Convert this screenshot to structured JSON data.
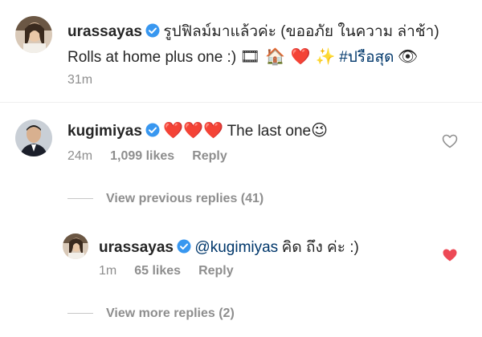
{
  "caption": {
    "username": "urassayas",
    "text_line1": "รูปฟิลม์มาแล้วค่ะ (ขออภัย ในความ ล่าช้า)",
    "text_line2": "Rolls at home plus one :)",
    "emojis": "🎞 🏠 ❤️ ✨",
    "hashtag": "#ปรือสุด",
    "trailing_emoji": "👁",
    "time": "31m"
  },
  "comment": {
    "username": "kugimiyas",
    "hearts": "❤️❤️❤️",
    "text": "The last one",
    "wink": "😉",
    "time": "24m",
    "likes": "1,099 likes",
    "reply_label": "Reply"
  },
  "view_previous": "View previous replies (41)",
  "reply": {
    "username": "urassayas",
    "mention": "@kugimiyas",
    "text": "คิด ถึง ค่ะ :)",
    "time": "1m",
    "likes": "65 likes",
    "reply_label": "Reply"
  },
  "view_more": "View more replies (2)",
  "colors": {
    "verified_blue": "#3897f0",
    "heart_red": "#ed4956",
    "meta_gray": "#8e8e8e",
    "link": "#00376b"
  }
}
